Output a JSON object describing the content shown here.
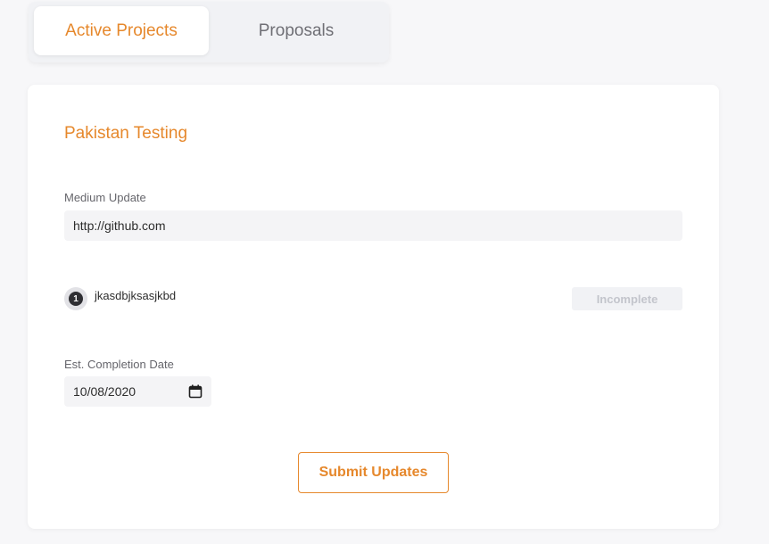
{
  "tabs": [
    {
      "label": "Active Projects",
      "active": true
    },
    {
      "label": "Proposals",
      "active": false
    }
  ],
  "project": {
    "title": "Pakistan Testing",
    "medium_update": {
      "label": "Medium Update",
      "value": "http://github.com"
    },
    "milestone": {
      "number": "1",
      "name": "jkasdbjksasjkbd",
      "status": "Incomplete"
    },
    "completion_date": {
      "label": "Est. Completion Date",
      "value": "10/08/2020"
    },
    "submit_label": "Submit Updates"
  },
  "colors": {
    "accent": "#e6882c",
    "background": "#f7f7f9",
    "card": "#ffffff",
    "input_bg": "#f4f4f6"
  },
  "icons": {
    "date_picker": "calendar-icon"
  }
}
